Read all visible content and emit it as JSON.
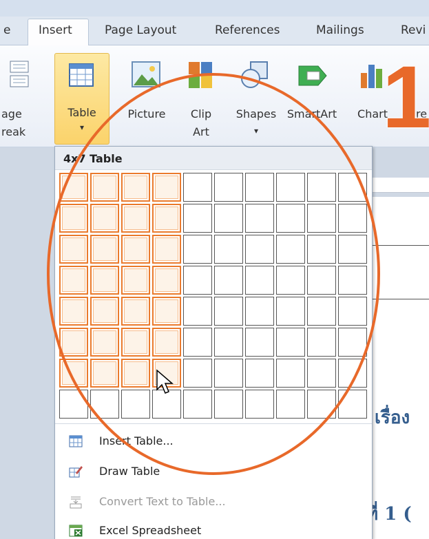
{
  "tabs": {
    "prev_partial": "e",
    "insert": "Insert",
    "page_layout": "Page Layout",
    "references": "References",
    "mailings": "Mailings",
    "review_partial": "Revi"
  },
  "ribbon": {
    "page_break_line1": "age",
    "page_break_line2": "reak",
    "table": "Table",
    "table_arrow": "▾",
    "picture": "Picture",
    "clipart_line1": "Clip",
    "clipart_line2": "Art",
    "shapes": "Shapes",
    "shapes_arrow": "▾",
    "smartart": "SmartArt",
    "chart": "Chart",
    "screenshot_partial": "re"
  },
  "table_dropdown": {
    "header": "4x7 Table",
    "grid_columns": 10,
    "grid_rows": 8,
    "selected_columns": 4,
    "selected_rows": 7,
    "highlight_color": "#ea7a2c"
  },
  "menu": {
    "insert_table": "Insert Table...",
    "draw_table": "Draw Table",
    "convert_text": "Convert Text to Table...",
    "excel_spreadsheet": "Excel Spreadsheet"
  },
  "document": {
    "thai_text_1": "เรื่อง",
    "thai_text_2": "ที่ 1 ("
  },
  "annotation": {
    "step_number": "1",
    "color": "#e8692a"
  }
}
